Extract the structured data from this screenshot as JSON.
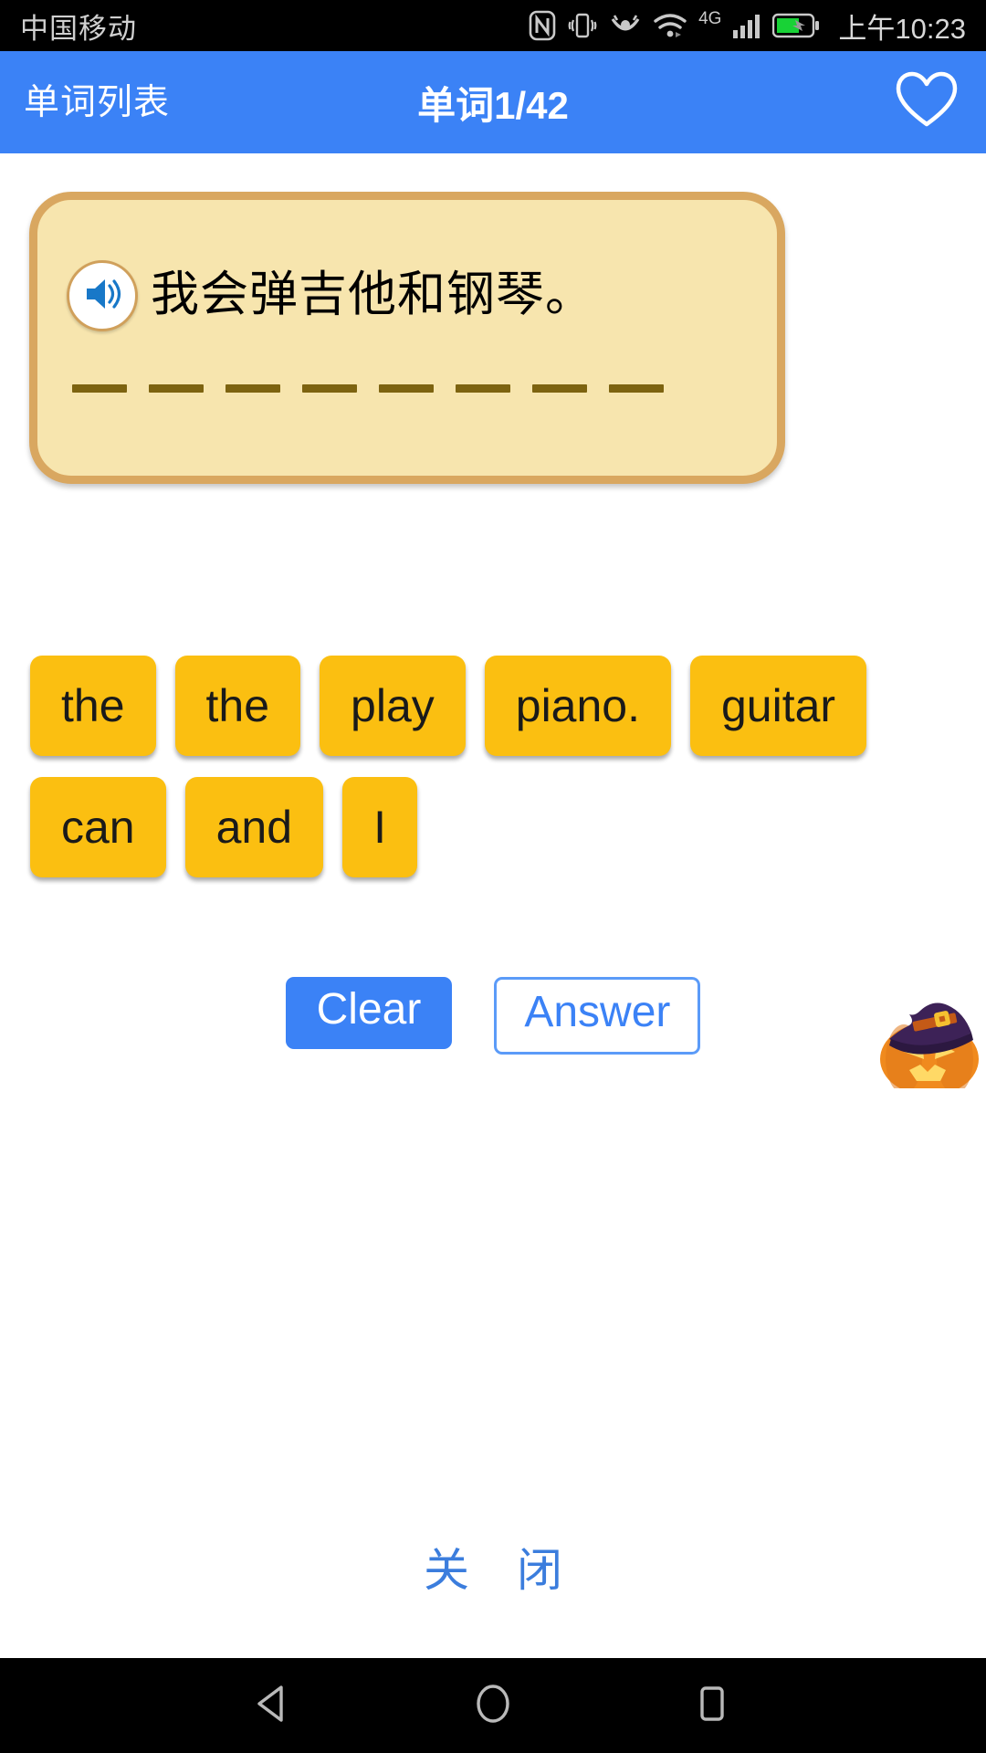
{
  "status_bar": {
    "carrier": "中国移动",
    "time": "上午10:23",
    "icons": [
      "nfc-icon",
      "vibrate-icon",
      "eye-comfort-icon",
      "wifi-icon",
      "network-4g-icon",
      "signal-bars-icon",
      "battery-charging-icon"
    ],
    "network_label": "4G"
  },
  "app_bar": {
    "back_label": "单词列表",
    "title": "单词1/42",
    "favorite_icon": "heart-outline-icon"
  },
  "card": {
    "speaker_icon": "speaker-sound-icon",
    "prompt": "我会弹吉他和钢琴。",
    "blank_count": 8,
    "background_color": "#f7e5ae",
    "border_color": "#d9a760",
    "blank_color": "#7d6310"
  },
  "word_tiles": [
    {
      "label": "the"
    },
    {
      "label": "the"
    },
    {
      "label": "play"
    },
    {
      "label": "piano."
    },
    {
      "label": "guitar"
    },
    {
      "label": "can"
    },
    {
      "label": "and"
    },
    {
      "label": "I"
    }
  ],
  "tile_color": "#fbbf11",
  "actions": {
    "clear_label": "Clear",
    "answer_label": "Answer",
    "accent_color": "#3b82f6",
    "decoration_icon": "halloween-pumpkin-witch-hat-icon"
  },
  "close_link": {
    "label": "关 闭",
    "color": "#3b7ddd"
  },
  "nav_bar": {
    "back_icon": "back-triangle-icon",
    "home_icon": "home-circle-icon",
    "recents_icon": "recents-square-icon"
  }
}
